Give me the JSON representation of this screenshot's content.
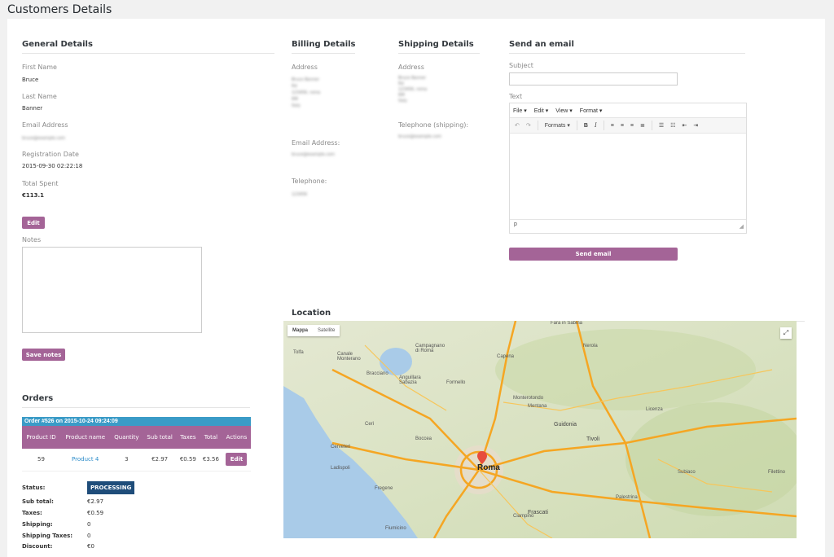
{
  "page_title": "Customers Details",
  "general": {
    "heading": "General Details",
    "first_name_label": "First Name",
    "first_name": "Bruce",
    "last_name_label": "Last Name",
    "last_name": "Banner",
    "email_label": "Email Address",
    "email": "bruce@example.com",
    "reg_label": "Registration Date",
    "reg_date": "2015-09-30 02:22:18",
    "spent_label": "Total Spent",
    "spent": "€113.1",
    "edit_label": "Edit",
    "notes_label": "Notes",
    "save_notes_label": "Save notes"
  },
  "billing": {
    "heading": "Billing Details",
    "address_label": "Address",
    "address": "Bruce Banner\nRd\n123456, roma\nRM\nItaly",
    "email_label": "Email Address:",
    "email": "bruce@example.com",
    "phone_label": "Telephone:",
    "phone": "123456"
  },
  "shipping": {
    "heading": "Shipping Details",
    "address_label": "Address",
    "address": "Bruce Banner\nRd\n123456, roma\nRM\nItaly",
    "phone_label": "Telephone (shipping):",
    "phone": "bruce@example.com"
  },
  "email": {
    "heading": "Send an email",
    "subject_label": "Subject",
    "text_label": "Text",
    "menu": [
      "File ▾",
      "Edit ▾",
      "View ▾",
      "Format ▾"
    ],
    "formats_label": "Formats ▾",
    "path_label": "p",
    "send_label": "Send email"
  },
  "location": {
    "heading": "Location",
    "map_tab": "Mappa",
    "satellite_tab": "Satellite",
    "city_label": "Roma",
    "places": [
      "Tolfa",
      "Canale Monterano",
      "Bracciano",
      "Anguillara Sabazia",
      "Formello",
      "Capena",
      "Monterotondo",
      "Mentana",
      "Guidonia",
      "Tivoli",
      "Cerveteri",
      "Ladispoli",
      "Fiumicino",
      "Fregene",
      "Frascati",
      "Ciampino",
      "Palestrina",
      "Subiaco",
      "Licenza",
      "Fara in Sabina",
      "Filettino",
      "Cerì",
      "Boccea",
      "Campagnano di Roma",
      "Nerola"
    ]
  },
  "orders": {
    "heading": "Orders",
    "order_title": "Order #526 on 2015-10-24 09:24:09",
    "columns": [
      "Product ID",
      "Product name",
      "Quantity",
      "Sub total",
      "Taxes",
      "Total",
      "Actions"
    ],
    "row": {
      "id": "59",
      "name": "Product 4",
      "qty": "3",
      "subtotal": "€2.97",
      "taxes": "€0.59",
      "total": "€3.56",
      "action": "Edit"
    },
    "status_label": "Status:",
    "status": "PROCESSING",
    "summary": [
      {
        "label": "Sub total:",
        "value": "€2.97"
      },
      {
        "label": "Taxes:",
        "value": "€0.59"
      },
      {
        "label": "Shipping:",
        "value": "0"
      },
      {
        "label": "Shipping Taxes:",
        "value": "0"
      },
      {
        "label": "Discount:",
        "value": "€0"
      }
    ]
  }
}
